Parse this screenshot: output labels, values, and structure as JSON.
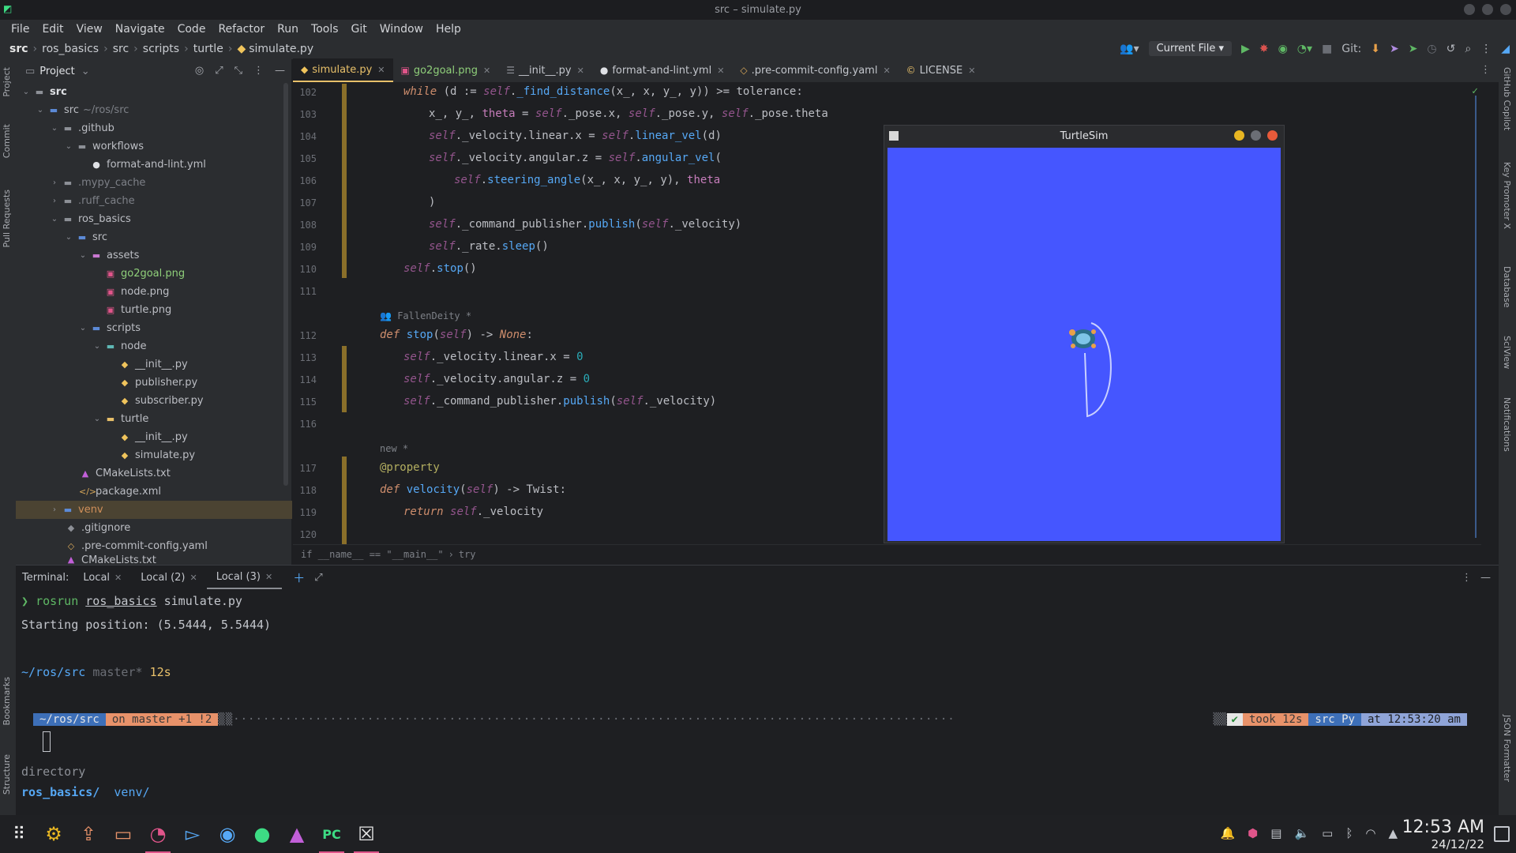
{
  "window": {
    "title": "src – simulate.py"
  },
  "menu": [
    "File",
    "Edit",
    "View",
    "Navigate",
    "Code",
    "Refactor",
    "Run",
    "Tools",
    "Git",
    "Window",
    "Help"
  ],
  "navbar": {
    "crumbs": [
      "src",
      "ros_basics",
      "src",
      "scripts",
      "turtle",
      "simulate.py"
    ],
    "run_config": "Current File",
    "git_label": "Git:"
  },
  "left_strip": [
    "Project",
    "Commit",
    "Pull Requests",
    "Bookmarks",
    "Structure"
  ],
  "right_strip": [
    "GitHub Copilot",
    "Key Promoter X",
    "Database",
    "SciView",
    "Notifications",
    "JSON Formatter"
  ],
  "project": {
    "title": "Project",
    "tree": [
      {
        "label": "src",
        "extra": "",
        "icon": "folder-icon"
      },
      {
        "label": "src",
        "extra": "~/ros/src",
        "icon": "source-folder-icon"
      },
      {
        "label": ".github",
        "extra": "",
        "icon": "folder-icon"
      },
      {
        "label": "workflows",
        "extra": "",
        "icon": "folder-icon"
      },
      {
        "label": "format-and-lint.yml",
        "extra": "",
        "icon": "github-icon"
      },
      {
        "label": ".mypy_cache",
        "extra": "",
        "icon": "folder-icon"
      },
      {
        "label": ".ruff_cache",
        "extra": "",
        "icon": "folder-icon"
      },
      {
        "label": "ros_basics",
        "extra": "",
        "icon": "folder-icon"
      },
      {
        "label": "src",
        "extra": "",
        "icon": "source-folder-icon"
      },
      {
        "label": "assets",
        "extra": "",
        "icon": "resource-folder-icon"
      },
      {
        "label": "go2goal.png",
        "extra": "",
        "icon": "image-icon"
      },
      {
        "label": "node.png",
        "extra": "",
        "icon": "image-icon"
      },
      {
        "label": "turtle.png",
        "extra": "",
        "icon": "image-icon"
      },
      {
        "label": "scripts",
        "extra": "",
        "icon": "folder-icon"
      },
      {
        "label": "node",
        "extra": "",
        "icon": "package-icon"
      },
      {
        "label": "__init__.py",
        "extra": "",
        "icon": "python-icon"
      },
      {
        "label": "publisher.py",
        "extra": "",
        "icon": "python-icon"
      },
      {
        "label": "subscriber.py",
        "extra": "",
        "icon": "python-icon"
      },
      {
        "label": "turtle",
        "extra": "",
        "icon": "folder-icon"
      },
      {
        "label": "__init__.py",
        "extra": "",
        "icon": "python-icon"
      },
      {
        "label": "simulate.py",
        "extra": "",
        "icon": "python-icon"
      },
      {
        "label": "CMakeLists.txt",
        "extra": "",
        "icon": "cmake-icon"
      },
      {
        "label": "package.xml",
        "extra": "",
        "icon": "xml-icon"
      },
      {
        "label": "venv",
        "extra": "",
        "icon": "python-venv-icon"
      },
      {
        "label": ".gitignore",
        "extra": "",
        "icon": "gitignore-icon"
      },
      {
        "label": ".pre-commit-config.yaml",
        "extra": "",
        "icon": "yaml-icon"
      },
      {
        "label": "CMakeLists.txt",
        "extra": "",
        "icon": "cmake-icon"
      }
    ]
  },
  "tabs": [
    {
      "label": "simulate.py",
      "icon": "python-icon"
    },
    {
      "label": "go2goal.png",
      "icon": "image-icon"
    },
    {
      "label": "__init__.py",
      "icon": "python-icon"
    },
    {
      "label": "format-and-lint.yml",
      "icon": "github-icon"
    },
    {
      "label": ".pre-commit-config.yaml",
      "icon": "yaml-icon"
    },
    {
      "label": "LICENSE",
      "icon": "license-icon"
    }
  ],
  "editor": {
    "line_numbers": [
      "102",
      "103",
      "104",
      "105",
      "106",
      "107",
      "108",
      "109",
      "110",
      "111",
      "112",
      "113",
      "114",
      "115",
      "116",
      "117",
      "118",
      "119",
      "120"
    ],
    "author_hint": "FallenDeity *",
    "new_hint": "new *",
    "breadcrumb": [
      "if __name__ == \"__main__\"",
      "try"
    ]
  },
  "turtlesim": {
    "title": "TurtleSim",
    "background": "#4556ff"
  },
  "terminal": {
    "label": "Terminal:",
    "tabs": [
      "Local",
      "Local (2)",
      "Local (3)"
    ],
    "lines": {
      "cmd_prefix": "❯ ",
      "cmd": "rosrun",
      "cmd_arg1": "ros_basics",
      "cmd_arg2": "simulate.py",
      "start": "Starting position: (5.5444, 5.5444)",
      "path": "~/ros/src",
      "branch": "master*",
      "took": "12s",
      "directory": "directory",
      "listing1": "ros_basics/",
      "listing2": "venv/"
    },
    "prompt_left": {
      "path": "~/ros/src",
      "git": "on master +1 !2"
    },
    "prompt_right": {
      "check": "✔",
      "took": "took 12s",
      "env": "src Py",
      "at": "at 12:53:20 am"
    }
  },
  "taskbar": {
    "time": "12:53 AM",
    "date": "24/12/22"
  }
}
